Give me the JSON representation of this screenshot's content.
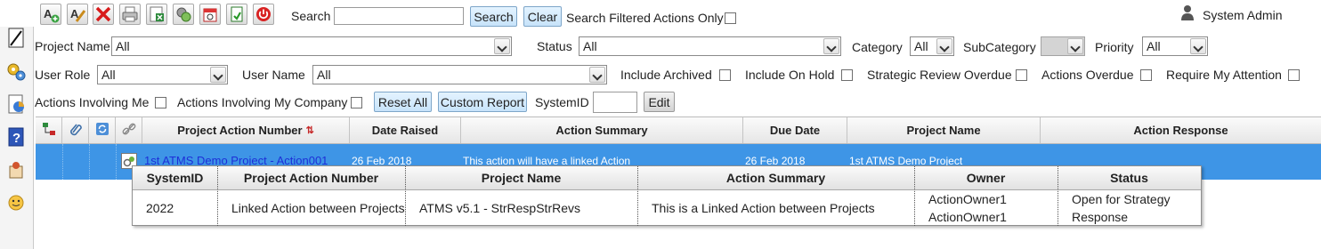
{
  "toolbar": {
    "icons": [
      "add-action-icon",
      "edit-action-icon",
      "delete-action-icon",
      "print-icon",
      "export-excel-icon",
      "link-actions-icon",
      "calendar-icon",
      "save-icon",
      "power-icon"
    ],
    "search_label": "Search",
    "search_value": "",
    "search_button": "Search",
    "clear_button": "Clear",
    "filtered_only_label": "Search Filtered Actions Only"
  },
  "user": {
    "name": "System Admin"
  },
  "filters": {
    "project_name_label": "Project Name",
    "project_name_value": "All",
    "status_label": "Status",
    "status_value": "All",
    "category_label": "Category",
    "category_value": "All",
    "subcategory_label": "SubCategory",
    "subcategory_value": "",
    "priority_label": "Priority",
    "priority_value": "All",
    "user_role_label": "User Role",
    "user_role_value": "All",
    "user_name_label": "User Name",
    "user_name_value": "All",
    "include_archived": "Include Archived",
    "include_on_hold": "Include On Hold",
    "strategic_review_overdue": "Strategic Review Overdue",
    "actions_overdue": "Actions Overdue",
    "require_my_attention": "Require My Attention",
    "actions_involving_me": "Actions Involving Me",
    "actions_involving_company": "Actions Involving My Company",
    "reset_all": "Reset All",
    "custom_report": "Custom Report",
    "systemid_label": "SystemID",
    "systemid_value": "",
    "edit_button": "Edit"
  },
  "grid": {
    "headers": [
      "Project Action Number",
      "Date Raised",
      "Action Summary",
      "Due Date",
      "Project Name",
      "Action Response"
    ],
    "row": {
      "action_number": "1st ATMS Demo Project - Action001",
      "date_raised": "26 Feb 2018",
      "summary": "This action will have a linked Action",
      "due_date": "26 Feb 2018",
      "project_name": "1st ATMS Demo Project",
      "response": ""
    }
  },
  "linked_popup": {
    "headers": [
      "SystemID",
      "Project Action Number",
      "Project Name",
      "Action Summary",
      "Owner",
      "Status"
    ],
    "row": {
      "system_id": "2022",
      "action_number": "Linked Action between Projects",
      "project_name": "ATMS v5.1 - StrRespStrRevs",
      "summary": "This is a Linked Action between Projects",
      "owner_line1": "ActionOwner1",
      "owner_line2": "ActionOwner1",
      "status_line1": "Open for Strategy",
      "status_line2": "Response"
    }
  },
  "colors": {
    "selected_row": "#3e95e6",
    "link": "#1d2fd8",
    "button": "#c7e3fa"
  }
}
